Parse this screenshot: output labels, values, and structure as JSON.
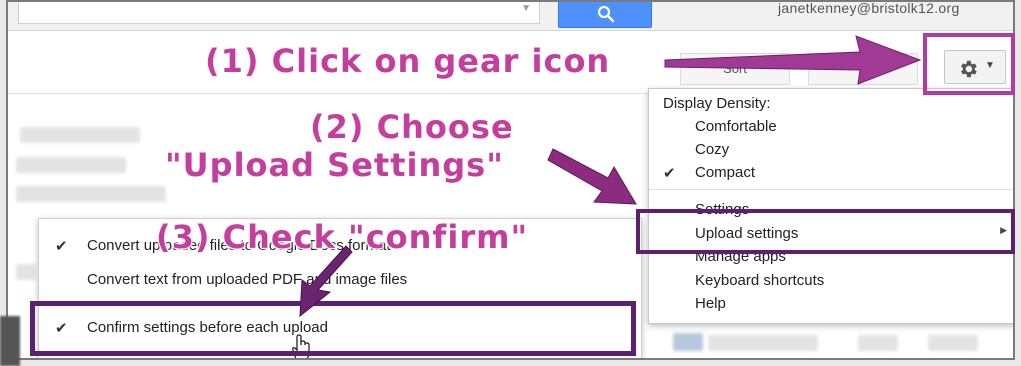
{
  "account": {
    "email": "janetkenney@bristolk12.org"
  },
  "toolbar": {
    "sort_label": "Sort"
  },
  "gear_menu": {
    "heading": "Display Density:",
    "density_options": [
      {
        "label": "Comfortable",
        "checked": false
      },
      {
        "label": "Cozy",
        "checked": false
      },
      {
        "label": "Compact",
        "checked": true
      }
    ],
    "items": [
      "Settings",
      "Upload settings",
      "Manage apps",
      "Keyboard shortcuts",
      "Help"
    ]
  },
  "upload_menu": {
    "items": [
      {
        "label": "Convert uploaded files to Google Docs format",
        "checked": true
      },
      {
        "label": "Convert text from uploaded PDF and image files",
        "checked": false
      },
      {
        "label": "Confirm settings before each upload",
        "checked": true
      }
    ]
  },
  "annotations": {
    "step1": "(1) Click on gear icon",
    "step2_line1": "(2) Choose",
    "step2_line2": "\"Upload Settings\"",
    "step3": "(3) Check \"confirm\""
  },
  "colors": {
    "annotation_text": "#c43e9e",
    "highlight_purple": "#5b2170",
    "highlight_magenta": "#b23aa2",
    "search_button": "#4d90fe"
  },
  "icons": {
    "check": "✔",
    "submenu_arrow": "▶",
    "caret": "▼"
  }
}
